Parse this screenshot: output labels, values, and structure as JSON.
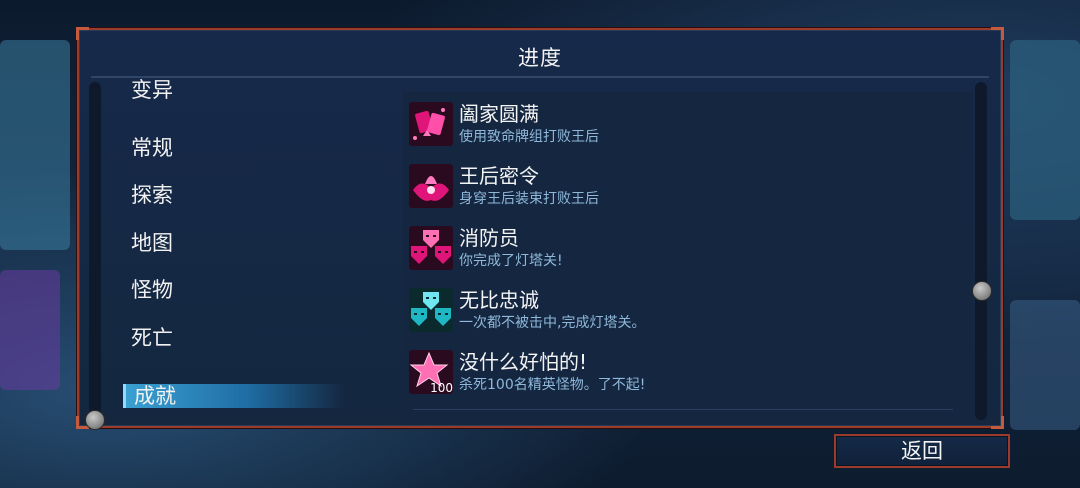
{
  "panel": {
    "title": "进度"
  },
  "menu": {
    "items": [
      {
        "label": "变异"
      },
      {
        "label": "常规"
      },
      {
        "label": "探索"
      },
      {
        "label": "地图"
      },
      {
        "label": "怪物"
      },
      {
        "label": "死亡"
      },
      {
        "label": "成就",
        "selected": true
      }
    ]
  },
  "achievements": [
    {
      "name": "阖家圆满",
      "description": "使用致命牌组打败王后",
      "icon": "card-deck-icon",
      "color": "#e0157a"
    },
    {
      "name": "王后密令",
      "description": "身穿王后装束打败王后",
      "icon": "queen-crown-icon",
      "color": "#e0157a"
    },
    {
      "name": "消防员",
      "description": "你完成了灯塔关!",
      "icon": "masks-icon",
      "color": "#e0157a"
    },
    {
      "name": "无比忠诚",
      "description": "一次都不被击中,完成灯塔关。",
      "icon": "masks-icon",
      "color": "#1fb7c4"
    },
    {
      "name": "没什么好怕的!",
      "description": "杀死100名精英怪物。了不起!",
      "icon": "star-icon",
      "icon_text": "100",
      "color": "#e0157a"
    }
  ],
  "buttons": {
    "back_label": "返回"
  }
}
